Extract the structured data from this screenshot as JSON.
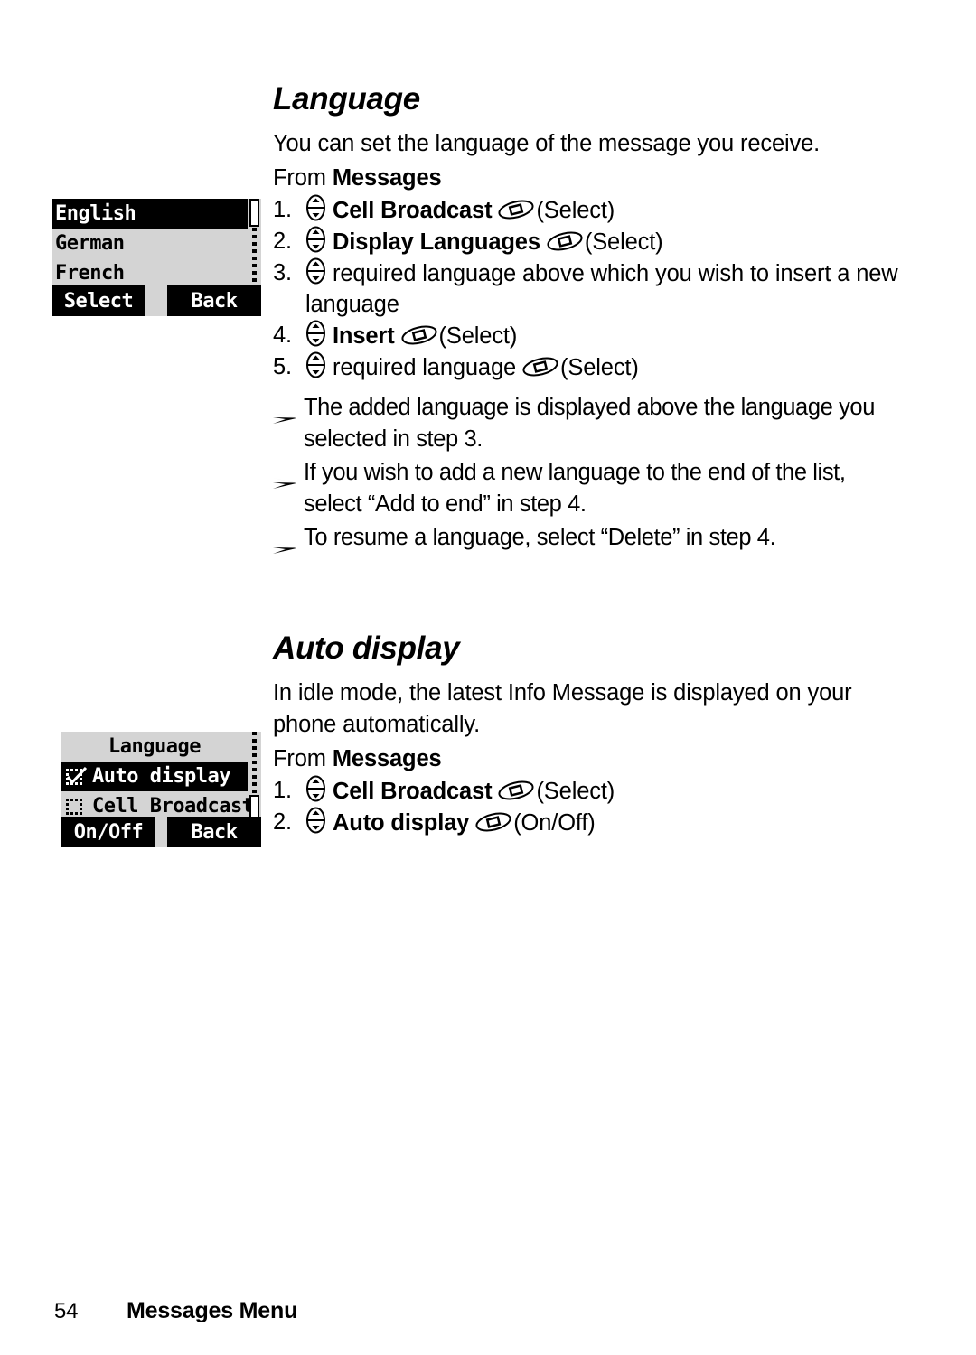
{
  "document": {
    "footer": {
      "page_number": "54",
      "section_title": "Messages Menu"
    }
  },
  "sections": [
    {
      "heading": "Language",
      "intro": "You can set the language of the message you receive.",
      "from_prefix": "From ",
      "from_target": "Messages",
      "steps": [
        {
          "num": "1.",
          "label": "Cell Broadcast",
          "bold": true,
          "action": "(Select)"
        },
        {
          "num": "2.",
          "label": "Display Languages",
          "bold": true,
          "action": "(Select)"
        },
        {
          "num": "3.",
          "label": "required language above which you wish to insert a new language",
          "bold": false,
          "action": ""
        },
        {
          "num": "4.",
          "label": "Insert",
          "bold": true,
          "action": "(Select)"
        },
        {
          "num": "5.",
          "label": "required language",
          "bold": false,
          "action": "(Select)"
        }
      ],
      "notes": [
        "The added language is displayed above the language you selected in step 3.",
        "If you wish to add a new language to the end of the list, select “Add to end” in step 4.",
        "To resume a language, select “Delete” in step 4."
      ]
    },
    {
      "heading": "Auto display",
      "intro": "In idle mode, the latest Info Message is displayed on your phone automatically.",
      "from_prefix": "From ",
      "from_target": "Messages",
      "steps": [
        {
          "num": "1.",
          "label": "Cell Broadcast",
          "bold": true,
          "action": "(Select)"
        },
        {
          "num": "2.",
          "label": "Auto display",
          "bold": true,
          "action": "(On/Off)"
        }
      ],
      "notes": []
    }
  ],
  "screens": [
    {
      "id": "language-list",
      "rows": [
        {
          "label": "English",
          "selected": true,
          "checkbox": "none",
          "centered": false
        },
        {
          "label": "German",
          "selected": false,
          "checkbox": "none",
          "centered": false
        },
        {
          "label": "French",
          "selected": false,
          "checkbox": "none",
          "centered": false
        }
      ],
      "softkeys": {
        "left": "Select",
        "right": "Back"
      },
      "scrollbar_position": "top"
    },
    {
      "id": "cell-broadcast-menu",
      "rows": [
        {
          "label": "Language",
          "selected": false,
          "checkbox": "none",
          "centered": true
        },
        {
          "label": "Auto display",
          "selected": true,
          "checkbox": "checked",
          "centered": false
        },
        {
          "label": "Cell Broadcast",
          "selected": false,
          "checkbox": "unchecked",
          "centered": false
        }
      ],
      "softkeys": {
        "left": "On/Off",
        "right": "Back"
      },
      "scrollbar_position": "bottom"
    }
  ],
  "icons": {
    "nav_key": "nav-key-updown-icon",
    "soft_key": "soft-key-icon",
    "note_marker": "arrow-bullet-icon",
    "checkbox_checked": "checkbox-checked-icon",
    "checkbox_unchecked": "checkbox-unchecked-icon"
  }
}
